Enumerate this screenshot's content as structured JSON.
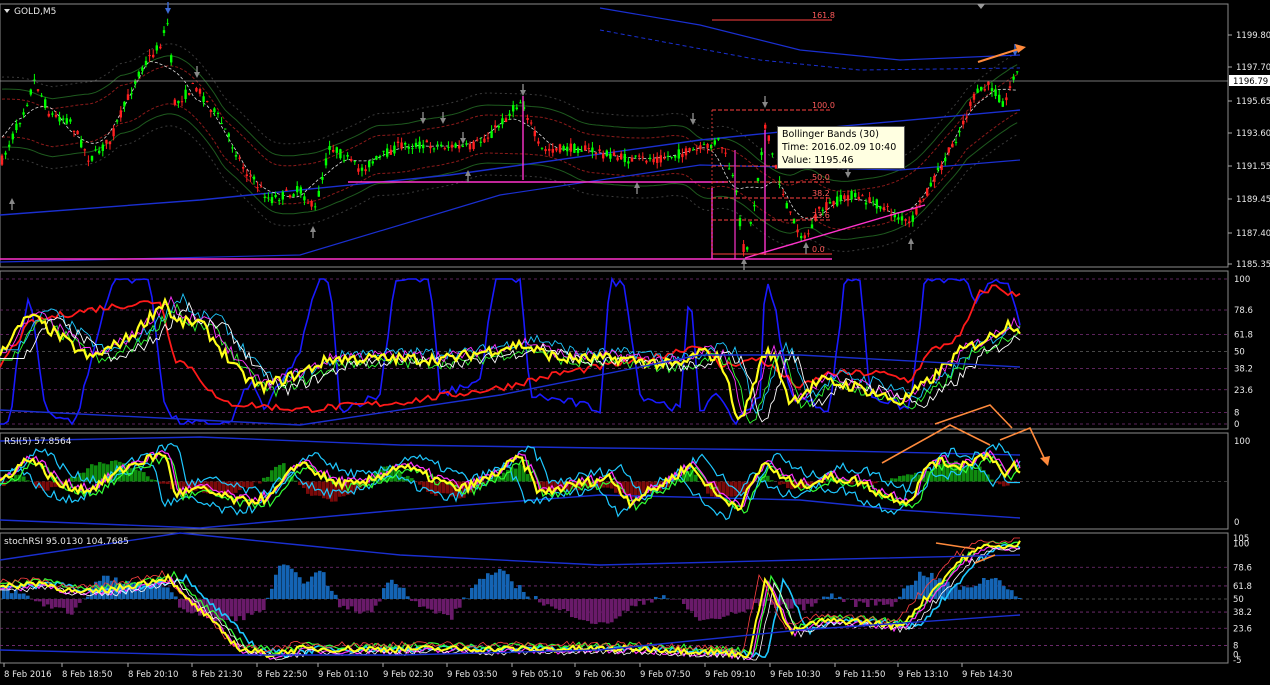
{
  "window": {
    "symbol_title": "GOLD,M5",
    "menu_arrow_icon": "dropdown-triangle-icon"
  },
  "price_panel": {
    "y_labels": [
      "1199.80",
      "1197.70",
      "1195.65",
      "1193.60",
      "1191.55",
      "1189.45",
      "1187.40",
      "1185.35"
    ],
    "current_price": "1196.79",
    "fib_levels": [
      "161.8",
      "100.0",
      "61.8",
      "50.0",
      "38.2",
      "23.6",
      "0.0"
    ],
    "colors": {
      "bull": "#00ff00",
      "bear": "#ff2020",
      "fib": "#ff4040",
      "trendline": "#ff33cc"
    }
  },
  "tooltip": {
    "line1": "Bollinger Bands (30)",
    "line2": "Time: 2016.02.09 10:40",
    "line3": "Value: 1195.46"
  },
  "panel2": {
    "y_labels": [
      "100",
      "78.6",
      "61.8",
      "50",
      "38.2",
      "23.6",
      "8",
      "0"
    ]
  },
  "panel3": {
    "title": "RSI(5) 57.8564",
    "y_labels": [
      "100",
      "0"
    ]
  },
  "panel4": {
    "title": "stochRSI 95.0130 104.7685",
    "y_labels": [
      "105",
      "100",
      "78.6",
      "61.8",
      "50",
      "38.2",
      "23.6",
      "8",
      "0",
      "-5"
    ]
  },
  "time_axis": {
    "labels": [
      "8 Feb 2016",
      "8 Feb 18:50",
      "8 Feb 20:10",
      "8 Feb 21:30",
      "8 Feb 22:50",
      "9 Feb 01:10",
      "9 Feb 02:30",
      "9 Feb 03:50",
      "9 Feb 05:10",
      "9 Feb 06:30",
      "9 Feb 07:50",
      "9 Feb 09:10",
      "9 Feb 10:30",
      "9 Feb 11:50",
      "9 Feb 13:10",
      "9 Feb 14:30"
    ]
  }
}
